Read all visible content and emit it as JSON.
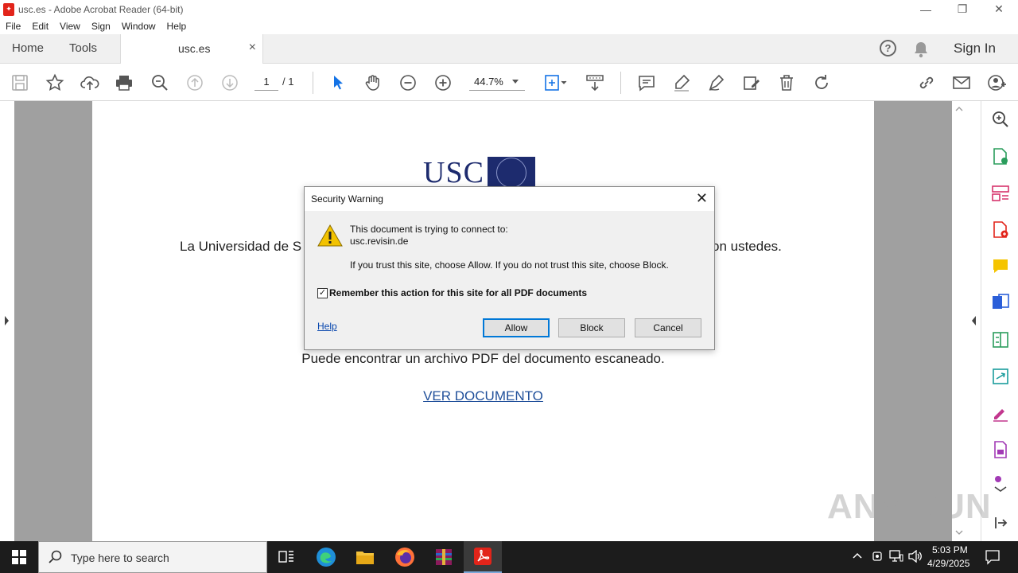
{
  "window": {
    "title": "usc.es - Adobe Acrobat Reader (64-bit)",
    "minimize": "—",
    "maximize": "❐",
    "close": "✕"
  },
  "menu": {
    "items": [
      "File",
      "Edit",
      "View",
      "Sign",
      "Window",
      "Help"
    ]
  },
  "tabs": {
    "home": "Home",
    "tools": "Tools",
    "document": "usc.es",
    "document_close": "×",
    "sign_in": "Sign In"
  },
  "toolbar": {
    "page_current": "1",
    "page_total": "/ 1",
    "zoom": "44.7%"
  },
  "document": {
    "logo_text": "USC",
    "line1_left": "La Universidad de S",
    "line1_right": "on ustedes.",
    "line2": "Puede encontrar un archivo PDF del documento escaneado.",
    "link": "VER DOCUMENTO"
  },
  "dialog": {
    "title": "Security Warning",
    "message_intro": "This document is trying to connect to:",
    "site": "usc.revisin.de",
    "message_trust": "If you trust this site, choose Allow. If you do not trust this site, choose Block.",
    "remember_label": "Remember this action for this site for all PDF documents",
    "remember_checked": true,
    "help": "Help",
    "allow": "Allow",
    "block": "Block",
    "cancel": "Cancel"
  },
  "taskbar": {
    "search_placeholder": "Type here to search",
    "time": "5:03 PM",
    "date": "4/29/2025"
  },
  "watermark": "ANY RUN",
  "colors": {
    "acrobat_red": "#e2241a",
    "usc_blue": "#1d2b6e",
    "accent_blue": "#0078d7",
    "link_blue": "#1f4f9a"
  }
}
